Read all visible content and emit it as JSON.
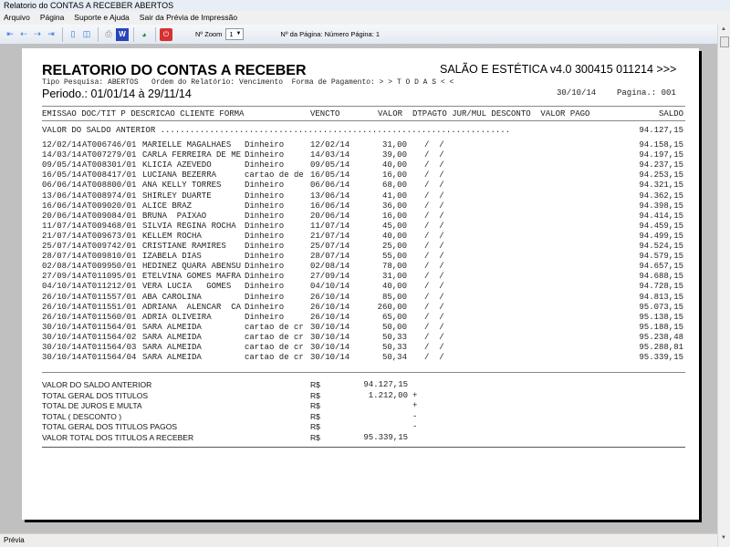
{
  "window": {
    "title": "Relatorio do CONTAS A RECEBER ABERTOS"
  },
  "menu": [
    "Arquivo",
    "Página",
    "Suporte e Ajuda",
    "Sair da Prévia de Impressão"
  ],
  "toolbar": {
    "zoom_label": "Nº Zoom",
    "zoom_value": "1",
    "page_info": "Nº da Página: Número Página: 1"
  },
  "status": "Prévia",
  "report": {
    "title": "RELATORIO DO CONTAS A RECEBER",
    "company": "SALÃO E ESTÉTICA v4.0 300415 011214 >>>",
    "filters": "Tipo Pesquisa: ABERTOS   Ordem do Relatório: Vencimento  Forma de Pagamento: > > T O D A S < <",
    "period": "Periodo.: 01/01/14 à 29/11/14",
    "date": "30/10/14",
    "page": "Pagina.: 001",
    "columns": {
      "left": "EMISSAO DOC/TIT P DESCRICAO CLIENTE FORMA",
      "vencto": "VENCTO",
      "valor": "VALOR",
      "rest": "DTPAGTO JUR/MUL DESCONTO  VALOR PAGO",
      "saldo": "SALDO"
    },
    "saldo_anterior_label": "VALOR DO SALDO ANTERIOR .......................................................................",
    "saldo_anterior": "94.127,15",
    "rows": [
      [
        "12/02/14",
        "AT006746/01",
        "MARIELLE MAGALHAES",
        "Dinheiro",
        "12/02/14",
        "31,00",
        "/  /",
        "94.158,15"
      ],
      [
        "14/03/14",
        "AT007279/01",
        "CARLA FERREIRA DE ME",
        "Dinheiro",
        "14/03/14",
        "39,00",
        "/  /",
        "94.197,15"
      ],
      [
        "09/05/14",
        "AT008301/01",
        "KLICIA AZEVEDO",
        "Dinheiro",
        "09/05/14",
        "40,00",
        "/  /",
        "94.237,15"
      ],
      [
        "16/05/14",
        "AT008417/01",
        "LUCIANA BEZERRA",
        "cartao de de",
        "16/05/14",
        "16,00",
        "/  /",
        "94.253,15"
      ],
      [
        "06/06/14",
        "AT008800/01",
        "ANA KELLY TORRES",
        "Dinheiro",
        "06/06/14",
        "68,00",
        "/  /",
        "94.321,15"
      ],
      [
        "13/06/14",
        "AT008974/01",
        "SHIRLEY DUARTE",
        "Dinheiro",
        "13/06/14",
        "41,00",
        "/  /",
        "94.362,15"
      ],
      [
        "16/06/14",
        "AT009020/01",
        "ALICE BRAZ",
        "Dinheiro",
        "16/06/14",
        "36,00",
        "/  /",
        "94.398,15"
      ],
      [
        "20/06/14",
        "AT009084/01",
        "BRUNA  PAIXAO",
        "Dinheiro",
        "20/06/14",
        "16,00",
        "/  /",
        "94.414,15"
      ],
      [
        "11/07/14",
        "AT009468/01",
        "SILVIA REGINA ROCHA",
        "Dinheiro",
        "11/07/14",
        "45,00",
        "/  /",
        "94.459,15"
      ],
      [
        "21/07/14",
        "AT009673/01",
        "KELLEM ROCHA",
        "Dinheiro",
        "21/07/14",
        "40,00",
        "/  /",
        "94.499,15"
      ],
      [
        "25/07/14",
        "AT009742/01",
        "CRISTIANE RAMIRES",
        "Dinheiro",
        "25/07/14",
        "25,00",
        "/  /",
        "94.524,15"
      ],
      [
        "28/07/14",
        "AT009810/01",
        "IZABELA DIAS",
        "Dinheiro",
        "28/07/14",
        "55,00",
        "/  /",
        "94.579,15"
      ],
      [
        "02/08/14",
        "AT009950/01",
        "HEDINEZ QUARA ABENSU",
        "Dinheiro",
        "02/08/14",
        "78,00",
        "/  /",
        "94.657,15"
      ],
      [
        "27/09/14",
        "AT011095/01",
        "ETELVINA GOMES MAFRA",
        "Dinheiro",
        "27/09/14",
        "31,00",
        "/  /",
        "94.688,15"
      ],
      [
        "04/10/14",
        "AT011212/01",
        "VERA LUCIA   GOMES",
        "Dinheiro",
        "04/10/14",
        "40,00",
        "/  /",
        "94.728,15"
      ],
      [
        "26/10/14",
        "AT011557/01",
        "ABA CAROLINA",
        "Dinheiro",
        "26/10/14",
        "85,00",
        "/  /",
        "94.813,15"
      ],
      [
        "26/10/14",
        "AT011551/01",
        "ADRIANA  ALENCAR  CA",
        "Dinheiro",
        "26/10/14",
        "260,00",
        "/  /",
        "95.073,15"
      ],
      [
        "26/10/14",
        "AT011560/01",
        "ADRIA OLIVEIRA",
        "Dinheiro",
        "26/10/14",
        "65,00",
        "/  /",
        "95.138,15"
      ],
      [
        "30/10/14",
        "AT011564/01",
        "SARA ALMEIDA",
        "cartao de cr",
        "30/10/14",
        "50,00",
        "/  /",
        "95.188,15"
      ],
      [
        "30/10/14",
        "AT011564/02",
        "SARA ALMEIDA",
        "cartao de cr",
        "30/10/14",
        "50,33",
        "/  /",
        "95.238,48"
      ],
      [
        "30/10/14",
        "AT011564/03",
        "SARA ALMEIDA",
        "cartao de cr",
        "30/10/14",
        "50,33",
        "/  /",
        "95.288,81"
      ],
      [
        "30/10/14",
        "AT011564/04",
        "SARA ALMEIDA",
        "cartao de cr",
        "30/10/14",
        "50,34",
        "/  /",
        "95.339,15"
      ]
    ],
    "summary": [
      {
        "label": "VALOR DO SALDO ANTERIOR",
        "currency": "R$",
        "value": "94.127,15",
        "sign": ""
      },
      {
        "label": "TOTAL GERAL DOS TITULOS",
        "currency": "R$",
        "value": "1.212,00",
        "sign": "+"
      },
      {
        "label": "TOTAL DE JUROS E MULTA",
        "currency": "R$",
        "value": "",
        "sign": "+"
      },
      {
        "label": "TOTAL ( DESCONTO )",
        "currency": "R$",
        "value": "",
        "sign": "-"
      },
      {
        "label": "TOTAL GERAL DOS TITULOS PAGOS",
        "currency": "R$",
        "value": "",
        "sign": "-"
      },
      {
        "label": "VALOR TOTAL DOS TITULOS A RECEBER",
        "currency": "R$",
        "value": "95.339,15",
        "sign": ""
      }
    ]
  }
}
